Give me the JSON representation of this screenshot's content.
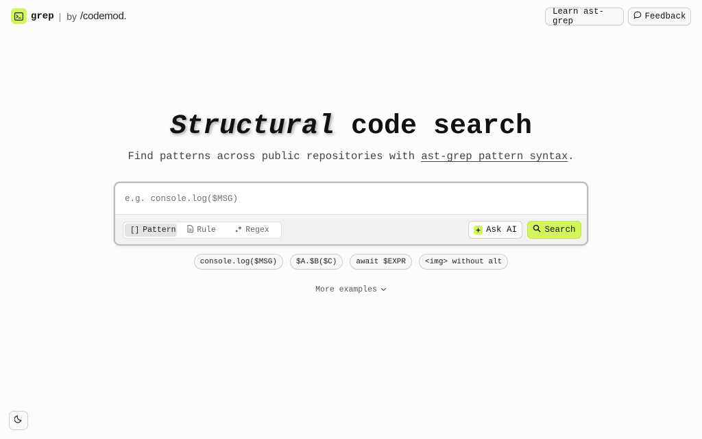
{
  "header": {
    "logo_name": "grep",
    "separator": "|",
    "by": "by",
    "brand": "/codemod.",
    "learn_label": "Learn ast-grep",
    "feedback_label": "Feedback"
  },
  "hero": {
    "title_emphasis": "Structural",
    "title_rest": " code search",
    "subtitle_prefix": "Find patterns across public repositories with ",
    "subtitle_link": "ast-grep pattern syntax",
    "subtitle_suffix": "."
  },
  "search": {
    "placeholder": "e.g. console.log($MSG)",
    "value": "",
    "modes": [
      {
        "label": "Pattern",
        "icon": "brackets-icon",
        "active": true
      },
      {
        "label": "Rule",
        "icon": "file-icon",
        "active": false
      },
      {
        "label": "Regex",
        "icon": "regex-icon",
        "active": false
      }
    ],
    "ask_ai_label": "Ask AI",
    "search_label": "Search"
  },
  "examples": [
    "console.log($MSG)",
    "$A.$B($C)",
    "await $EXPR",
    "<img> without alt"
  ],
  "more_examples_label": "More examples",
  "colors": {
    "accent": "#d4f55a",
    "background": "#fcfcfc",
    "text": "#1a1a1a"
  },
  "theme_toggle_icon": "moon-icon"
}
